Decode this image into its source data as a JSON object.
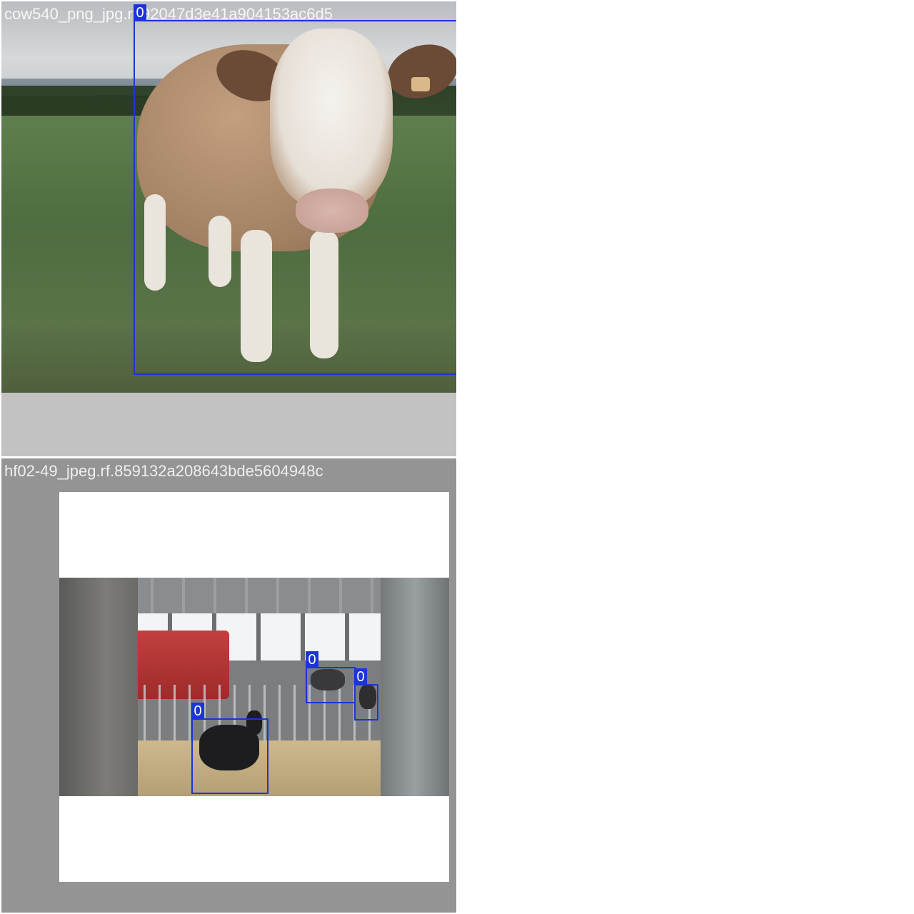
{
  "tiles": [
    {
      "filename": "cow540_png_jpg.rf.92047d3e41a904153ac6d5",
      "detections": [
        {
          "class_label": "0"
        }
      ]
    },
    {
      "filename": "hf02-49_jpeg.rf.859132a208643bde5604948c",
      "detections": [
        {
          "class_label": "0"
        },
        {
          "class_label": "0"
        },
        {
          "class_label": "0"
        }
      ]
    }
  ],
  "colors": {
    "box": "#1c34d8",
    "tile_1_background": "#c2c2c2",
    "tile_2_background": "#949494",
    "page_background": "#ffffff"
  }
}
